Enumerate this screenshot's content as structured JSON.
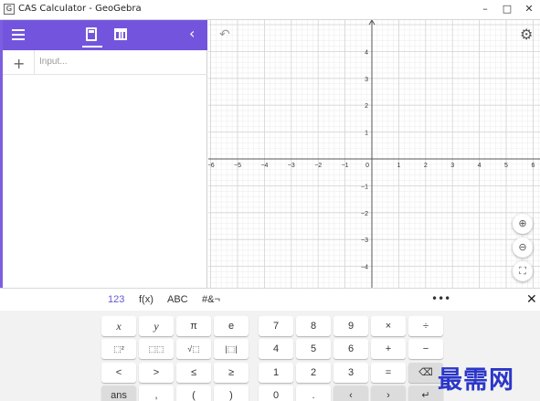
{
  "window": {
    "title": "CAS Calculator - GeoGebra",
    "app_icon": "geogebra-icon",
    "controls": [
      "–",
      "□",
      "✕"
    ]
  },
  "algebra": {
    "header_color": "#7355dd",
    "input_placeholder": "Input...",
    "icons": [
      "menu-icon",
      "calculator-icon",
      "table-icon",
      "chevron-left-icon",
      "plus-icon"
    ],
    "collapse_glyph": "‹",
    "add_glyph": "+"
  },
  "graphics": {
    "undo_glyph": "↶",
    "settings_glyph": "⚙",
    "zoom_in_glyph": "⊕",
    "zoom_out_glyph": "⊖",
    "fullscreen_glyph": "⛶",
    "x_range": [
      -6,
      6
    ],
    "y_range": [
      -4,
      4
    ],
    "x_ticks": [
      "−6",
      "−5",
      "−4",
      "−3",
      "−2",
      "−1",
      "0",
      "1",
      "2",
      "3",
      "4",
      "5",
      "6"
    ],
    "y_ticks": [
      "4",
      "3",
      "2",
      "1",
      "−1",
      "−2",
      "−3",
      "−4"
    ],
    "grid": true
  },
  "keyboard": {
    "tabs": [
      "123",
      "f(x)",
      "ABC",
      "#&¬"
    ],
    "active_tab": "123",
    "more_glyph": "•••",
    "close_glyph": "✕",
    "accent": "#6557d2",
    "rows": [
      [
        "x",
        "y",
        "π",
        "e",
        "7",
        "8",
        "9",
        "×",
        "÷"
      ],
      [
        "⬚²",
        "⬚⬚",
        "√⬚",
        "|⬚|",
        "4",
        "5",
        "6",
        "+",
        "−"
      ],
      [
        "<",
        ">",
        "≤",
        "≥",
        "1",
        "2",
        "3",
        "=",
        "⌫"
      ],
      [
        "ans",
        ",",
        "(",
        ")",
        "0",
        ".",
        "‹",
        "›",
        "↵"
      ]
    ]
  },
  "watermark": "最需网"
}
